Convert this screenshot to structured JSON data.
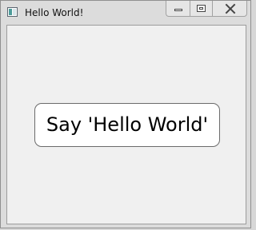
{
  "window": {
    "title": "Hello World!",
    "icon": "window-app-icon"
  },
  "title_bar": {
    "controls": [
      {
        "name": "minimize",
        "icon": "minimize-icon"
      },
      {
        "name": "maximize",
        "icon": "maximize-icon"
      },
      {
        "name": "close",
        "icon": "close-icon"
      }
    ]
  },
  "main": {
    "button_label": "Say 'Hello World'"
  }
}
